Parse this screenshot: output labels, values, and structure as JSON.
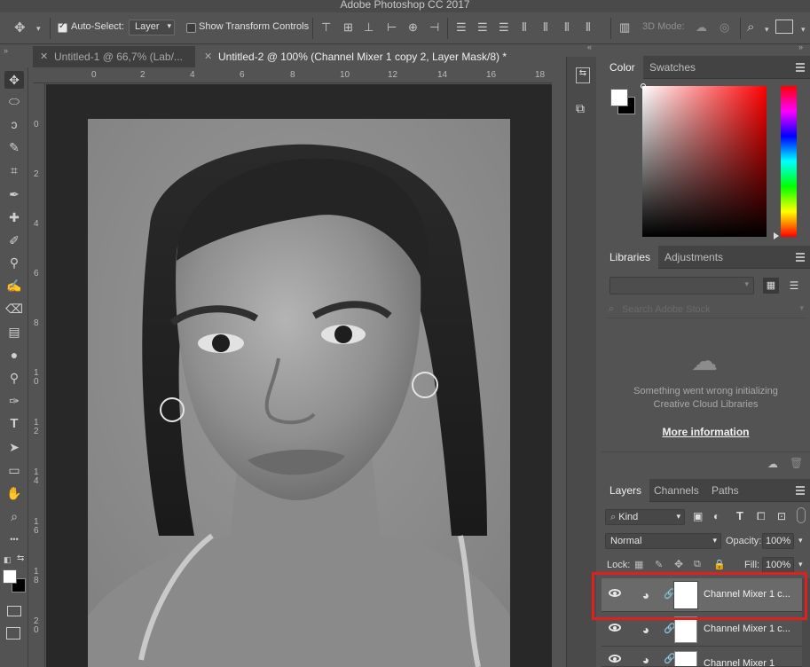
{
  "app": {
    "title": "Adobe Photoshop CC 2017"
  },
  "options_bar": {
    "auto_select_label": "Auto-Select:",
    "auto_select_value": "Layer",
    "show_transform_label": "Show Transform Controls",
    "mode_3d_label": "3D Mode:"
  },
  "tabs": [
    {
      "label": "Untitled-1 @ 66,7% (Lab/...",
      "active": false
    },
    {
      "label": "Untitled-2 @ 100% (Channel Mixer 1 copy 2, Layer Mask/8) *",
      "active": true
    }
  ],
  "ruler": {
    "h_ticks": [
      "0",
      "2",
      "4",
      "6",
      "8",
      "10",
      "12",
      "14",
      "16",
      "18"
    ],
    "v_ticks": [
      "0",
      "2",
      "4",
      "6",
      "8",
      "1 0",
      "1 2",
      "1 4",
      "1 6",
      "1 8",
      "2 0"
    ]
  },
  "tools": [
    "move-tool-icon",
    "marquee-tool-icon",
    "lasso-tool-icon",
    "quick-select-icon",
    "crop-tool-icon",
    "eyedropper-icon",
    "healing-brush-icon",
    "brush-tool-icon",
    "clone-stamp-icon",
    "history-brush-icon",
    "eraser-icon",
    "gradient-tool-icon",
    "blur-tool-icon",
    "dodge-tool-icon",
    "pen-tool-icon",
    "type-tool-icon",
    "path-select-icon",
    "rectangle-tool-icon",
    "hand-tool-icon",
    "zoom-tool-icon",
    "more-tools-icon"
  ],
  "color_panel": {
    "tabs": [
      "Color",
      "Swatches"
    ],
    "active_tab": "Color",
    "foreground": "#ffffff",
    "background": "#000000"
  },
  "libraries_panel": {
    "tabs": [
      "Libraries",
      "Adjustments"
    ],
    "active_tab": "Libraries",
    "search_placeholder": "Search Adobe Stock",
    "error_line1": "Something went wrong initializing",
    "error_line2": "Creative Cloud Libraries",
    "more_info_link": "More information"
  },
  "layers_panel": {
    "tabs": [
      "Layers",
      "Channels",
      "Paths"
    ],
    "active_tab": "Layers",
    "kind_label": "Kind",
    "blend_mode": "Normal",
    "opacity_label": "Opacity:",
    "opacity_value": "100%",
    "lock_label": "Lock:",
    "fill_label": "Fill:",
    "fill_value": "100%",
    "layers": [
      {
        "name": "Channel Mixer 1 c...",
        "selected": true
      },
      {
        "name": "Channel Mixer 1 c...",
        "selected": false
      },
      {
        "name": "Channel Mixer 1",
        "selected": false
      }
    ]
  },
  "colors": {
    "highlight_box": "#e0201f",
    "ui_bg": "#535353",
    "canvas_bg": "#282828"
  }
}
